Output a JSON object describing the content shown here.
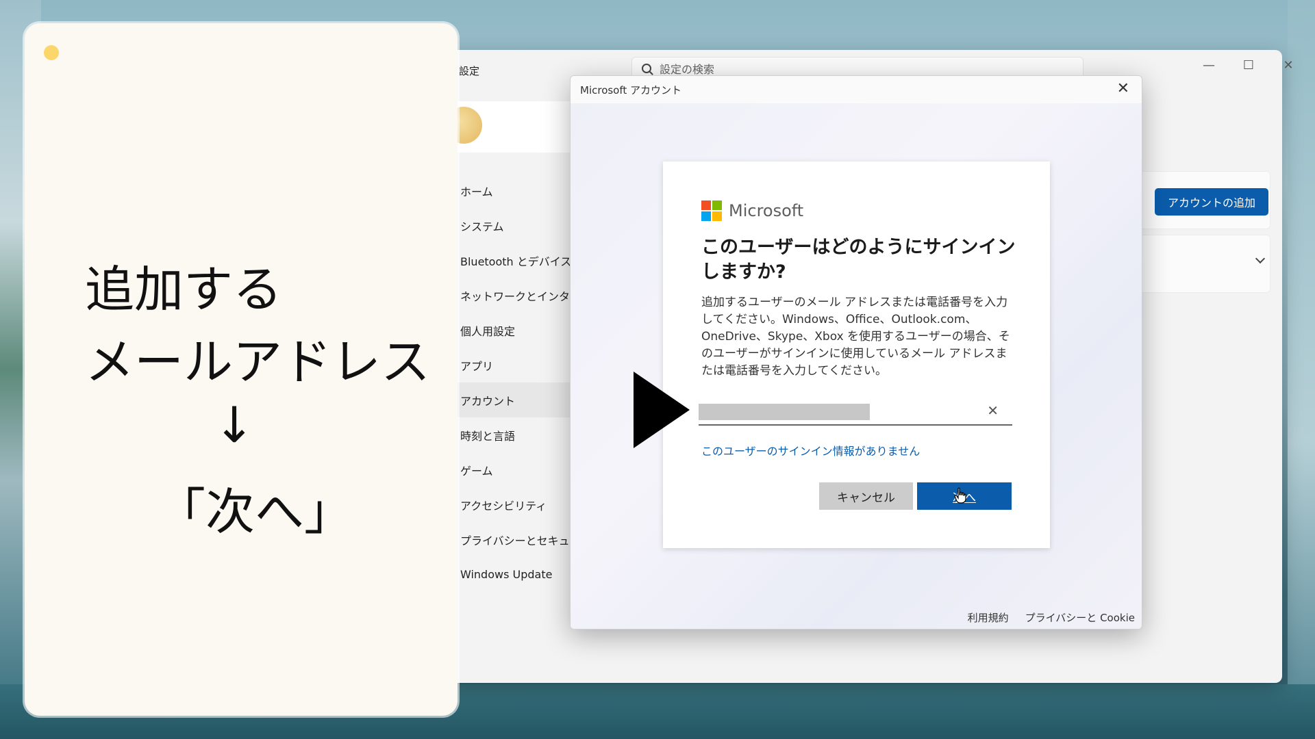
{
  "caption": {
    "line1": "追加する",
    "line2": "メールアドレス",
    "arrow": "↓",
    "line3": "「次へ」"
  },
  "settings": {
    "title": "設定",
    "search_placeholder": "設定の検索",
    "nav": [
      {
        "label": "ホーム"
      },
      {
        "label": "システム"
      },
      {
        "label": "Bluetooth とデバイス"
      },
      {
        "label": "ネットワークとインターネット"
      },
      {
        "label": "個人用設定"
      },
      {
        "label": "アプリ"
      },
      {
        "label": "アカウント"
      },
      {
        "label": "時刻と言語"
      },
      {
        "label": "ゲーム"
      },
      {
        "label": "アクセシビリティ"
      },
      {
        "label": "プライバシーとセキュリティ"
      },
      {
        "label": "Windows Update"
      }
    ],
    "add_account_label": "アカウントの追加"
  },
  "dialog": {
    "title": "Microsoft アカウント",
    "logo_text": "Microsoft",
    "heading": "このユーザーはどのようにサインインしますか?",
    "description": "追加するユーザーのメール アドレスまたは電話番号を入力してください。Windows、Office、Outlook.com、OneDrive、Skype、Xbox を使用するユーザーの場合、そのユーザーがサインインに使用しているメール アドレスまたは電話番号を入力してください。",
    "no_signin_link": "このユーザーのサインイン情報がありません",
    "cancel_label": "キャンセル",
    "next_label": "次へ",
    "footer_terms": "利用規約",
    "footer_privacy": "プライバシーと Cookie"
  },
  "colors": {
    "accent": "#0b5cab",
    "caption_bg": "#fcf8f2",
    "dot": "#fad66b"
  }
}
